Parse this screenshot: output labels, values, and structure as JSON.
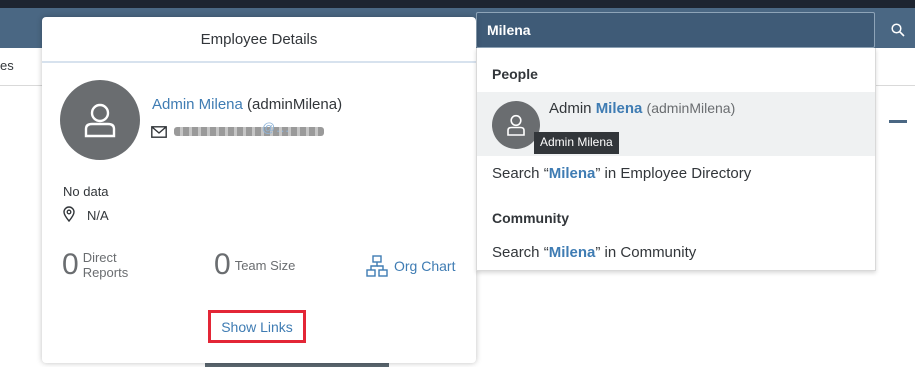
{
  "nav": {
    "fragment": "es"
  },
  "search": {
    "value": "Milena"
  },
  "card": {
    "title": "Employee Details",
    "name": "Admin Milena",
    "user_id": "(adminMilena)",
    "email_tail": "@...",
    "no_data": "No data",
    "location": "N/A",
    "direct_reports": {
      "value": "0",
      "label_line1": "Direct",
      "label_line2": "Reports"
    },
    "team_size": {
      "value": "0",
      "label": "Team Size"
    },
    "org_chart_label": "Org Chart",
    "show_links_label": "Show Links"
  },
  "dropdown": {
    "people_header": "People",
    "person": {
      "name_prefix": "Admin ",
      "name_highlight": "Milena",
      "user_id": "(adminMilena)"
    },
    "tooltip": "Admin Milena",
    "employee_directory_search": {
      "prefix": "Search “",
      "query": "Milena",
      "suffix": "” in Employee Directory"
    },
    "community_header": "Community",
    "community_search": {
      "prefix": "Search “",
      "query": "Milena",
      "suffix": "” in Community"
    }
  },
  "colors": {
    "shell": "#4a6783",
    "link": "#3f7cb3",
    "highlight_border": "#e32636"
  },
  "icons": [
    "search-icon",
    "person-icon",
    "mail-icon",
    "location-icon",
    "org-chart-icon"
  ]
}
